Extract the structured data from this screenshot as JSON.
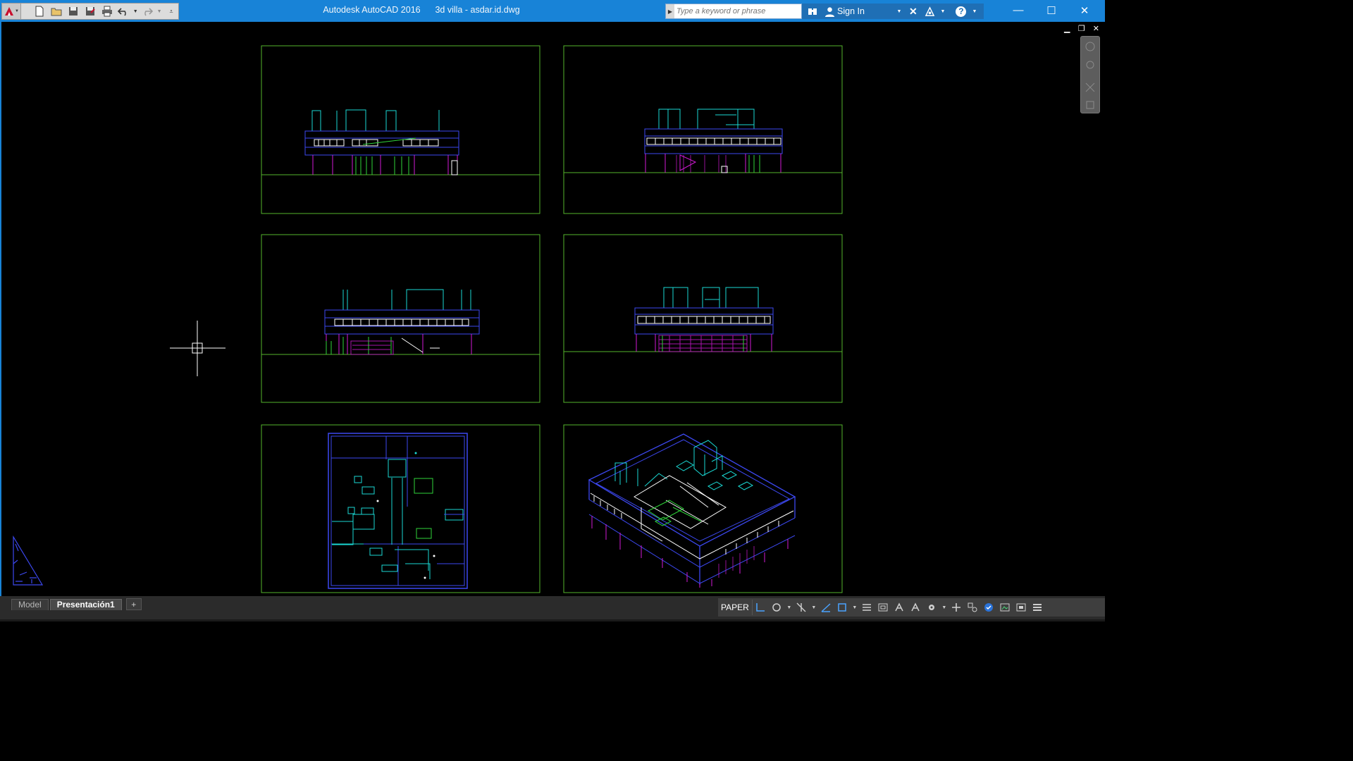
{
  "titlebar": {
    "app_name": "Autodesk AutoCAD 2016",
    "file_name": "3d villa - asdar.id.dwg",
    "search_placeholder": "Type a keyword or phrase",
    "sign_in_label": "Sign In",
    "help_label": "?"
  },
  "window_controls": {
    "minimize": "—",
    "maximize": "☐",
    "close": "✕"
  },
  "drawing": {
    "background_color": "#000000",
    "viewport_border_color": "#55b52c",
    "colors": {
      "cyan": "#1ad9d4",
      "blue": "#3c48f0",
      "magenta": "#d21ad6",
      "green": "#2fd43a",
      "white": "#ffffff"
    }
  },
  "tabs": {
    "model_label": "Model",
    "layout_label": "Presentación1",
    "add_label": "+"
  },
  "status_bar": {
    "space_label": "PAPER"
  },
  "icons": [
    "autocad-logo-icon",
    "new-icon",
    "open-icon",
    "save-icon",
    "save-as-icon",
    "plot-icon",
    "undo-icon",
    "redo-icon",
    "qat-dropdown-icon",
    "binoculars-icon",
    "user-icon",
    "exchange-icon",
    "a360-icon",
    "help-icon",
    "ucs-icon",
    "crosshair-cursor"
  ]
}
